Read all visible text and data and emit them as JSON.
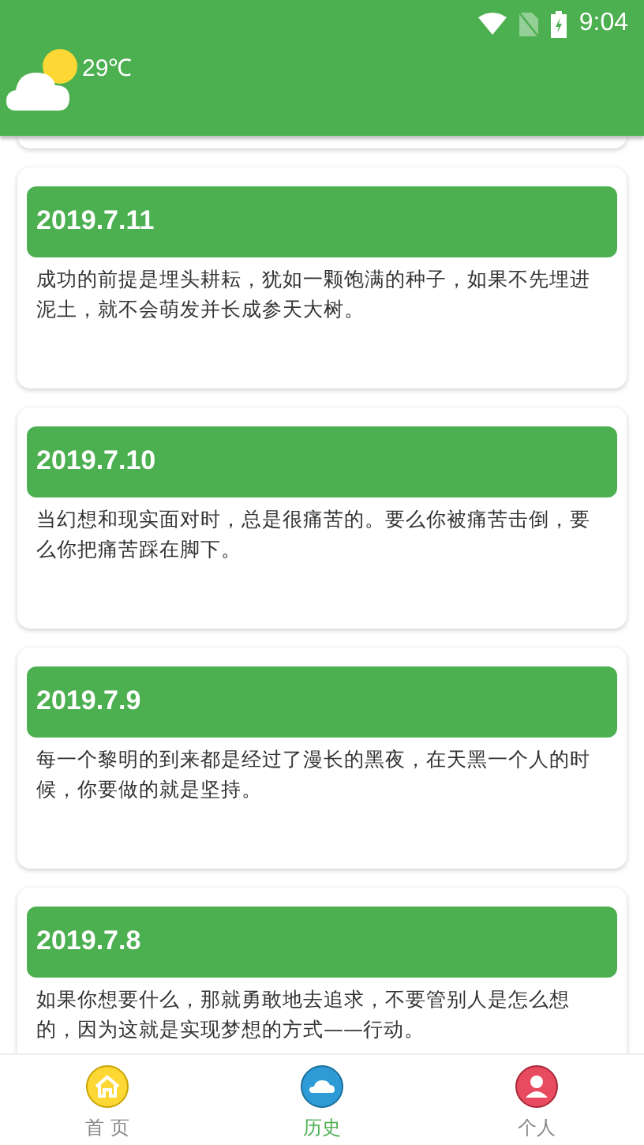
{
  "status_bar": {
    "time": "9:04"
  },
  "header": {
    "temperature": "29℃"
  },
  "entries": [
    {
      "date": "2019.7.11",
      "text": "成功的前提是埋头耕耘，犹如一颗饱满的种子，如果不先埋进泥土，就不会萌发并长成参天大树。"
    },
    {
      "date": "2019.7.10",
      "text": "当幻想和现实面对时，总是很痛苦的。要么你被痛苦击倒，要么你把痛苦踩在脚下。"
    },
    {
      "date": "2019.7.9",
      "text": "每一个黎明的到来都是经过了漫长的黑夜，在天黑一个人的时候，你要做的就是坚持。"
    },
    {
      "date": "2019.7.8",
      "text": "如果你想要什么，那就勇敢地去追求，不要管别人是怎么想的，因为这就是实现梦想的方式——行动。"
    }
  ],
  "nav": [
    {
      "label": "首 页",
      "kind": "home",
      "selected": false
    },
    {
      "label": "历史",
      "kind": "history",
      "selected": true
    },
    {
      "label": "个人",
      "kind": "profile",
      "selected": false
    }
  ]
}
